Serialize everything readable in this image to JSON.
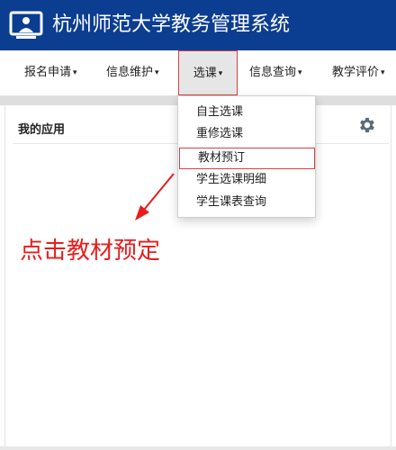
{
  "header": {
    "title": "杭州师范大学教务管理系统",
    "bg_color": "#0b3d91",
    "logo_icon": "monitor-person-icon"
  },
  "nav": {
    "items": [
      {
        "label": "报名申请"
      },
      {
        "label": "信息维护"
      },
      {
        "label": "选课"
      },
      {
        "label": "信息查询"
      },
      {
        "label": "教学评价"
      }
    ],
    "active_index": 2,
    "caret": "▾"
  },
  "dropdown": {
    "items": [
      {
        "label": "自主选课"
      },
      {
        "label": "重修选课"
      },
      {
        "label": "教材预订"
      },
      {
        "label": "学生选课明细"
      },
      {
        "label": "学生课表查询"
      }
    ],
    "highlight_index": 2
  },
  "panel": {
    "title": "我的应用",
    "settings_icon": "gear-icon"
  },
  "annotation": {
    "text": "点击教材预定",
    "color": "#e81c1c"
  }
}
